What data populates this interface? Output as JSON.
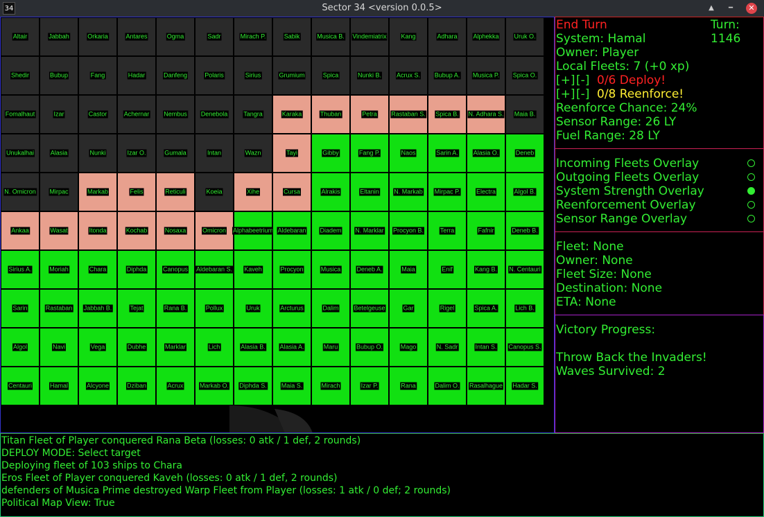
{
  "window": {
    "app_icon": "34",
    "title": "Sector 34    <version 0.0.5>",
    "controls": [
      "chevron-up-icon",
      "minimize-icon",
      "close-icon"
    ]
  },
  "colors": {
    "player": "#11e011",
    "enemy": "#e8a08e",
    "neutral": "#2a2a2a",
    "label_text": "#33ee33",
    "alert": "#ff2222",
    "warning": "#ffee33"
  },
  "map": {
    "owner_legend": {
      "P": "player",
      "E": "enemy",
      "N": "neutral"
    },
    "rows": [
      {
        "owners": "NNNNNNNNNNNNNN",
        "names": [
          "Altair",
          "Jabbah",
          "Orkaria",
          "Antares",
          "Ogma",
          "Sadr",
          "Mirach P.",
          "Sabik",
          "Musica B.",
          "Vindemiatrix",
          "Kang",
          "Adhara",
          "Alphekka",
          "Uruk O."
        ]
      },
      {
        "owners": "NNNNNNNNNNNNNN",
        "names": [
          "Shedir",
          "Bubup",
          "Fang",
          "Hadar",
          "Danfeng",
          "Polaris",
          "Sirius",
          "Grumium",
          "Spica",
          "Nunki B.",
          "Acrux S.",
          "Bubup A.",
          "Musica P.",
          "Spica O."
        ]
      },
      {
        "owners": "NNNNNNNEEEEEEN",
        "names": [
          "Fomalhaut",
          "Izar",
          "Castor",
          "Achernar",
          "Nembus",
          "Denebola",
          "Tangra",
          "Karaka",
          "Thuban",
          "Petra",
          "Rastaban S.",
          "Spica B.",
          "N. Adhara S.",
          "Maia B."
        ]
      },
      {
        "owners": "NNNNNNNEPPPPPP",
        "names": [
          "Unukalhai",
          "Alasia",
          "Nunki",
          "Izar O.",
          "Gumala",
          "Intan",
          "Wazn",
          "Tayi",
          "Gibby",
          "Fang P.",
          "Naos",
          "Sarin A.",
          "Alasia O.",
          "Deneb"
        ]
      },
      {
        "owners": "NNEEENEEPPPPPP",
        "names": [
          "N. Omicron",
          "Mirpac",
          "Markab",
          "Felis",
          "Reticuli",
          "Koeia",
          "Xihe",
          "Cursa",
          "Alrakis",
          "Eltanin",
          "N. Markab",
          "Mirpac P.",
          "Electra",
          "Algol B."
        ]
      },
      {
        "owners": "EEEEEEPPPPPPPP",
        "names": [
          "Ankaa",
          "Wasat",
          "Itonda",
          "Kochab",
          "Nosaxa",
          "Omicron",
          "Alphabeetrium",
          "Aldebaran",
          "Diadem",
          "N. Marklar",
          "Procyon B.",
          "Terra",
          "Fafnir",
          "Deneb B."
        ]
      },
      {
        "owners": "PPPPPPPPPPPPPP",
        "names": [
          "Sirius A.",
          "Moriah",
          "Chara",
          "Diphda",
          "Canopus",
          "Aldebaran S.",
          "Kaveh",
          "Procyon",
          "Musica",
          "Deneb A.",
          "Maia",
          "Enif",
          "Kang B.",
          "N. Centauri"
        ]
      },
      {
        "owners": "PPPPPPPPPPPPPP",
        "names": [
          "Sarin",
          "Rastaban",
          "Jabbah B.",
          "Tejat",
          "Rana B.",
          "Pollux",
          "Uruk",
          "Arcturus",
          "Dalim",
          "Betelgeuse",
          "Gar",
          "Rigel",
          "Spica A.",
          "Lich B."
        ]
      },
      {
        "owners": "PPPPPPPPPPPPPP",
        "names": [
          "Algol",
          "Navi",
          "Vega",
          "Dubhe",
          "Marklar",
          "Lich",
          "Alasia B.",
          "Alasia A.",
          "Maru",
          "Bubup O.",
          "Mago",
          "N. Sadr",
          "Intan S.",
          "Canopus S."
        ]
      },
      {
        "owners": "PPPPPPPPPPPPPP",
        "names": [
          "Centauri",
          "Hamal",
          "Alcyone",
          "Dziban",
          "Acrux",
          "Markab O.",
          "Diphda S.",
          "Maia S.",
          "Mirach",
          "Izar P.",
          "Rana",
          "Dalim O.",
          "Rasalhague",
          "Hadar S."
        ]
      }
    ]
  },
  "status": {
    "end_turn": "End Turn",
    "turn": "Turn: 1146",
    "system": "System: Hamal",
    "owner": "Owner: Player",
    "local_fleets": "Local Fleets: 7 (+0 xp)",
    "plus": "[+]",
    "minus": "[-]",
    "deploy": "0/6 Deploy!",
    "reenforce": "0/8 Reenforce!",
    "reenforce_chance": "Reenforce Chance: 24%",
    "sensor_range": "Sensor Range: 26 LY",
    "fuel_range": "Fuel Range: 28 LY"
  },
  "overlays": [
    {
      "label": "Incoming Fleets Overlay",
      "active": false
    },
    {
      "label": "Outgoing Fleets Overlay",
      "active": false
    },
    {
      "label": "System Strength Overlay",
      "active": true
    },
    {
      "label": "Reenforcement Overlay",
      "active": false
    },
    {
      "label": "Sensor Range Overlay",
      "active": false
    }
  ],
  "fleet": {
    "fleet": "Fleet: None",
    "owner": "Owner: None",
    "size": "Fleet Size: None",
    "destination": "Destination: None",
    "eta": "ETA: None"
  },
  "victory": {
    "title": "Victory Progress:",
    "objective": "Throw Back the Invaders!",
    "waves": "Waves Survived: 2"
  },
  "log": [
    "Titan Fleet of Player conquered Rana Beta (losses: 0 atk / 1 def, 2 rounds)",
    "DEPLOY MODE: Select target",
    "Deploying fleet of 103 ships to Chara",
    "Eros Fleet of Player conquered Kaveh (losses: 0 atk / 1 def, 2 rounds)",
    "defenders of Musica Prime destroyed Warp Fleet from Player (losses: 1 atk / 0 def; 2 rounds)",
    "Political Map View: True"
  ]
}
